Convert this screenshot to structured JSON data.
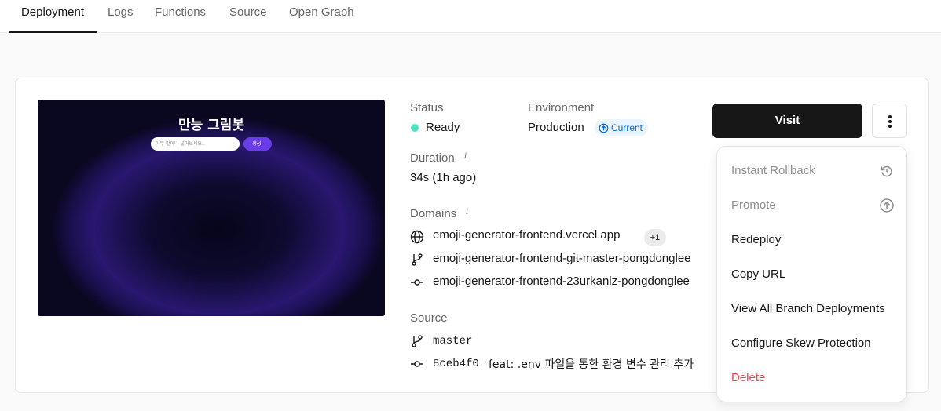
{
  "tabs": [
    "Deployment",
    "Logs",
    "Functions",
    "Source",
    "Open Graph"
  ],
  "preview": {
    "title": "만능 그림봇",
    "input_placeholder": "아무 말이나 넣어보세요..",
    "button_label": "생성!"
  },
  "status": {
    "label": "Status",
    "value": "Ready",
    "color": "#50e3c2"
  },
  "environment": {
    "label": "Environment",
    "value": "Production",
    "badge": "Current"
  },
  "duration": {
    "label": "Duration",
    "value": "34s (1h ago)"
  },
  "domains": {
    "label": "Domains",
    "items": [
      {
        "icon": "globe-icon",
        "text": "emoji-generator-frontend.vercel.app",
        "extra": "+1"
      },
      {
        "icon": "git-branch-icon",
        "text": "emoji-generator-frontend-git-master-pongdonglee"
      },
      {
        "icon": "git-commit-icon",
        "text": "emoji-generator-frontend-23urkanlz-pongdonglee"
      }
    ]
  },
  "source": {
    "label": "Source",
    "branch": "master",
    "commit_hash": "8ceb4f0",
    "commit_message": "feat: .env 파일을 통한 환경 변수 관리 추가"
  },
  "actions": {
    "visit_label": "Visit"
  },
  "menu": {
    "items": [
      {
        "label": "Instant Rollback",
        "disabled": true,
        "icon": "rollback-icon"
      },
      {
        "label": "Promote",
        "disabled": true,
        "icon": "arrow-up-circle-icon"
      },
      {
        "label": "Redeploy"
      },
      {
        "label": "Copy URL"
      },
      {
        "label": "View All Branch Deployments"
      },
      {
        "label": "Configure Skew Protection"
      },
      {
        "label": "Delete",
        "danger": true
      }
    ]
  },
  "colors": {
    "accent_blue": "#0068d6",
    "danger": "#e5484d",
    "ready": "#50e3c2"
  }
}
